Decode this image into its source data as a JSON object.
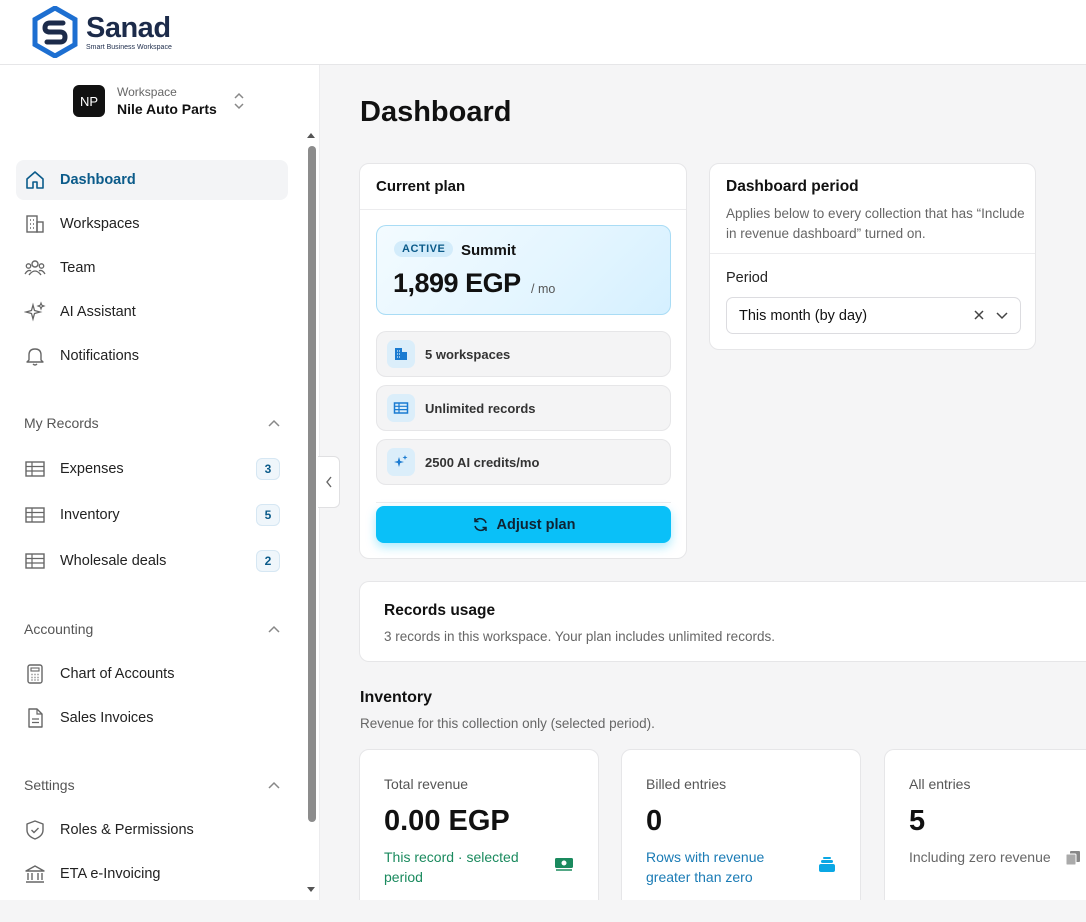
{
  "brand": {
    "name": "Sanad",
    "tagline": "Smart Business Workspace",
    "accent": "#0ac0f8",
    "navy": "#1c2b4a"
  },
  "workspace": {
    "initials": "NP",
    "label": "Workspace",
    "name": "Nile Auto Parts"
  },
  "nav": {
    "main": [
      {
        "label": "Dashboard",
        "icon": "home-icon",
        "active": true
      },
      {
        "label": "Workspaces",
        "icon": "building-icon"
      },
      {
        "label": "Team",
        "icon": "team-icon"
      },
      {
        "label": "AI Assistant",
        "icon": "sparkles-icon"
      },
      {
        "label": "Notifications",
        "icon": "bell-icon"
      }
    ],
    "records": {
      "title": "My Records",
      "items": [
        {
          "label": "Expenses",
          "count": "3",
          "icon": "table-icon"
        },
        {
          "label": "Inventory",
          "count": "5",
          "icon": "table-icon"
        },
        {
          "label": "Wholesale deals",
          "count": "2",
          "icon": "table-icon"
        }
      ]
    },
    "accounting": {
      "title": "Accounting",
      "items": [
        {
          "label": "Chart of Accounts",
          "icon": "calculator-icon"
        },
        {
          "label": "Sales Invoices",
          "icon": "document-icon"
        }
      ]
    },
    "settings": {
      "title": "Settings",
      "items": [
        {
          "label": "Roles & Permissions",
          "icon": "shield-icon"
        },
        {
          "label": "ETA e-Invoicing",
          "icon": "bank-icon"
        }
      ]
    }
  },
  "page": {
    "title": "Dashboard"
  },
  "plan": {
    "title": "Current plan",
    "status": "ACTIVE",
    "name": "Summit",
    "price": "1,899 EGP",
    "unit": "/ mo",
    "features": [
      {
        "label": "5 workspaces",
        "icon": "buildings-icon"
      },
      {
        "label": "Unlimited records",
        "icon": "table-icon"
      },
      {
        "label": "2500 AI credits/mo",
        "icon": "sparkles-icon"
      }
    ],
    "adjust_label": "Adjust plan"
  },
  "period": {
    "title": "Dashboard period",
    "subtitle": "Applies below to every collection that has “Include in revenue dashboard” turned on.",
    "label": "Period",
    "selected": "This month (by day)"
  },
  "usage": {
    "title": "Records usage",
    "subtitle": "3 records in this workspace. Your plan includes unlimited records."
  },
  "inventory": {
    "title": "Inventory",
    "subtitle": "Revenue for this collection only (selected period).",
    "stats": [
      {
        "label": "Total revenue",
        "value": "0.00 EGP",
        "note": "This record · selected period",
        "note_color": "#1a8a5e",
        "icon": "money-icon"
      },
      {
        "label": "Billed entries",
        "value": "0",
        "note": "Rows with revenue greater than zero",
        "note_color": "#1a7bb5",
        "icon": "stack-icon"
      },
      {
        "label": "All entries",
        "value": "5",
        "note": "Including zero revenue",
        "note_color": "#666666",
        "icon": "copy-icon"
      }
    ]
  }
}
